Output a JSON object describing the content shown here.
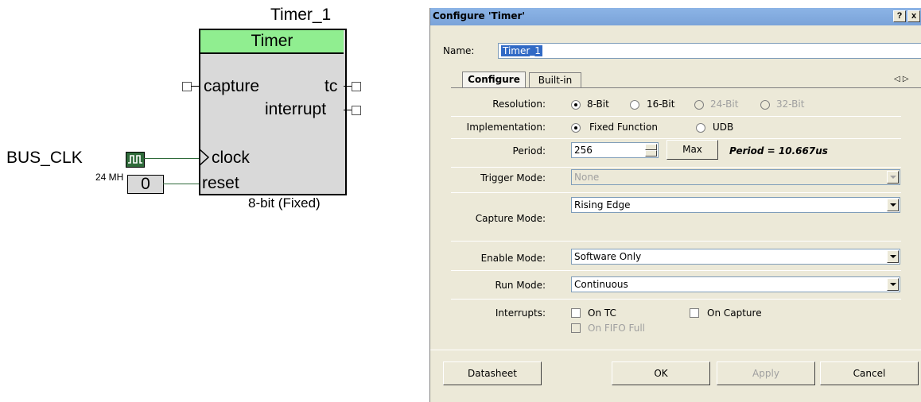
{
  "schematic": {
    "instance_name": "Timer_1",
    "component_title": "Timer",
    "pins": {
      "capture": "capture",
      "tc": "tc",
      "interrupt": "interrupt",
      "clock": "clock",
      "reset": "reset"
    },
    "clock_source": "BUS_CLK",
    "clock_freq": "24 MH",
    "reset_value": "0",
    "footer": "8-bit (Fixed)",
    "colors": {
      "header": "#90ee90",
      "body": "#d9d9d9",
      "wire": "#2f6b3a"
    }
  },
  "dialog": {
    "title": "Configure 'Timer'",
    "help_btn": "?",
    "close_btn": "x",
    "name_label": "Name:",
    "name_value": "Timer_1",
    "tabs": [
      {
        "label": "Configure"
      },
      {
        "label": "Built-in"
      }
    ],
    "scroll_arrows": "◁ ▷",
    "resolution": {
      "label": "Resolution:",
      "options": [
        "8-Bit",
        "16-Bit",
        "24-Bit",
        "32-Bit"
      ]
    },
    "implementation": {
      "label": "Implementation:",
      "options": [
        "Fixed Function",
        "UDB"
      ]
    },
    "period": {
      "label": "Period:",
      "value": "256",
      "max_btn": "Max",
      "result": "Period = 10.667us"
    },
    "trigger_mode": {
      "label": "Trigger Mode:",
      "value": "None"
    },
    "capture_mode": {
      "label": "Capture Mode:",
      "value": "Rising Edge"
    },
    "enable_mode": {
      "label": "Enable Mode:",
      "value": "Software Only"
    },
    "run_mode": {
      "label": "Run Mode:",
      "value": "Continuous"
    },
    "interrupts": {
      "label": "Interrupts:",
      "on_tc": "On TC",
      "on_capture": "On Capture",
      "on_fifo_full": "On FIFO Full"
    },
    "buttons": {
      "datasheet": "Datasheet",
      "ok": "OK",
      "apply": "Apply",
      "cancel": "Cancel"
    }
  }
}
